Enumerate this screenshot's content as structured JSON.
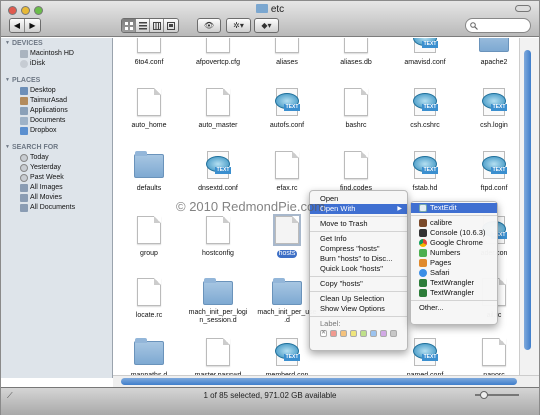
{
  "window": {
    "title": "etc"
  },
  "toolbar": {
    "back": "◀",
    "forward": "▶",
    "eye": "👁",
    "gear": "✲▾",
    "dropbox": "◆▾"
  },
  "sidebar": {
    "devices_header": "DEVICES",
    "devices": [
      "Macintosh HD",
      "iDisk"
    ],
    "places_header": "PLACES",
    "places": [
      "Desktop",
      "TaimurAsad",
      "Applications",
      "Documents",
      "Dropbox"
    ],
    "search_header": "SEARCH FOR",
    "search": [
      "Today",
      "Yesterday",
      "Past Week",
      "All Images",
      "All Movies",
      "All Documents"
    ]
  },
  "files": [
    {
      "name": "6to4.conf",
      "kind": "doc"
    },
    {
      "name": "afpovertcp.cfg",
      "kind": "doc"
    },
    {
      "name": "aliases",
      "kind": "doc"
    },
    {
      "name": "aliases.db",
      "kind": "doc"
    },
    {
      "name": "amavisd.conf",
      "kind": "te"
    },
    {
      "name": "apache2",
      "kind": "folder"
    },
    {
      "name": "auto_home",
      "kind": "doc"
    },
    {
      "name": "auto_master",
      "kind": "doc"
    },
    {
      "name": "autofs.conf",
      "kind": "te"
    },
    {
      "name": "bashrc",
      "kind": "doc"
    },
    {
      "name": "csh.cshrc",
      "kind": "te"
    },
    {
      "name": "csh.login",
      "kind": "te"
    },
    {
      "name": "defaults",
      "kind": "folder"
    },
    {
      "name": "dnsextd.conf",
      "kind": "te"
    },
    {
      "name": "efax.rc",
      "kind": "doc"
    },
    {
      "name": "find.codes",
      "kind": "doc"
    },
    {
      "name": "fstab.hd",
      "kind": "te"
    },
    {
      "name": "ftpd.conf",
      "kind": "te"
    },
    {
      "name": "group",
      "kind": "doc"
    },
    {
      "name": "hostconfig",
      "kind": "doc"
    },
    {
      "name": "hosts",
      "kind": "doc",
      "selected": true
    },
    {
      "name": "",
      "kind": "none"
    },
    {
      "name": "",
      "kind": "none"
    },
    {
      "name": "ader.con",
      "kind": "te"
    },
    {
      "name": "locate.rc",
      "kind": "doc"
    },
    {
      "name": "mach_init_per_logi\nn_session.d",
      "kind": "folder"
    },
    {
      "name": "mach_init_per_use\n.d",
      "kind": "folder"
    },
    {
      "name": "",
      "kind": "none"
    },
    {
      "name": "",
      "kind": "none"
    },
    {
      "name": "ail.rc",
      "kind": "doc"
    },
    {
      "name": "manpaths.d",
      "kind": "folder"
    },
    {
      "name": "master.passwd",
      "kind": "doc"
    },
    {
      "name": "memberd.con",
      "kind": "te"
    },
    {
      "name": "",
      "kind": "none"
    },
    {
      "name": "named.conf",
      "kind": "te"
    },
    {
      "name": "nanorc",
      "kind": "doc"
    },
    {
      "name": "",
      "kind": "te"
    },
    {
      "name": "",
      "kind": "te"
    },
    {
      "name": "",
      "kind": "te"
    },
    {
      "name": "",
      "kind": "te"
    },
    {
      "name": "",
      "kind": "te"
    },
    {
      "name": "",
      "kind": "te"
    }
  ],
  "context_menu": {
    "items": [
      "Open",
      "Open With",
      "Move to Trash",
      "Get Info",
      "Compress \"hosts\"",
      "Burn \"hosts\" to Disc...",
      "Quick Look \"hosts\"",
      "Copy \"hosts\"",
      "Clean Up Selection",
      "Show View Options"
    ],
    "label_title": "Label:"
  },
  "submenu": {
    "items": [
      "TextEdit",
      "calibre",
      "Console (10.6.3)",
      "Google Chrome",
      "Numbers",
      "Pages",
      "Safari",
      "TextWrangler",
      "TextWrangler",
      "Other..."
    ]
  },
  "status": "1 of 85 selected, 971.02 GB available",
  "watermark": "© 2010 RedmondPie.com",
  "colors": {
    "selection": "#3d6fc6",
    "menu_highlight": "#3f6fd1",
    "sidebar_bg": "#dee4ea"
  }
}
